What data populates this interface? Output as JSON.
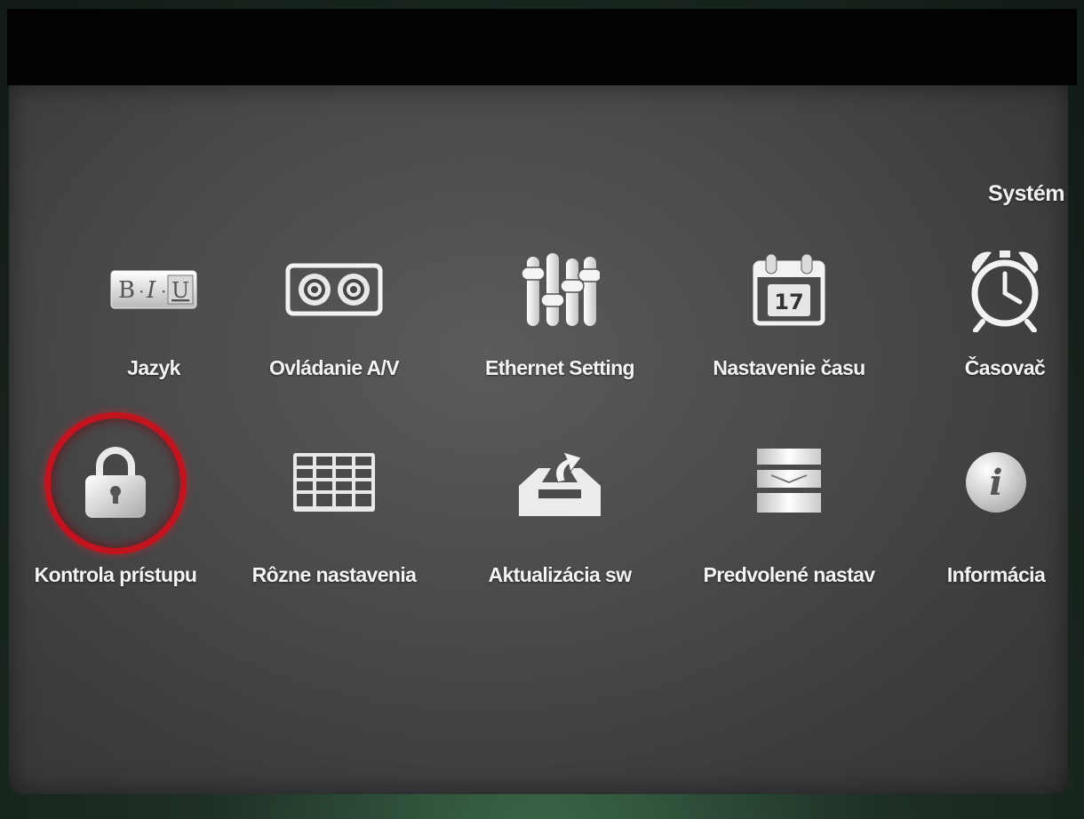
{
  "menu": {
    "title": "Systém",
    "accent_color": "#c2141f",
    "selected_index": 5,
    "items": [
      {
        "label": "Jazyk",
        "icon": "language-biu-icon"
      },
      {
        "label": "Ovládanie A/V",
        "icon": "av-speakers-icon"
      },
      {
        "label": "Ethernet Setting",
        "icon": "equalizer-sliders-icon"
      },
      {
        "label": "Nastavenie času",
        "icon": "calendar-icon",
        "icon_text": "17"
      },
      {
        "label": "Časovač",
        "icon": "alarm-clock-icon"
      },
      {
        "label": "Kontrola prístupu",
        "icon": "padlock-icon"
      },
      {
        "label": "Rôzne nastavenia",
        "icon": "grid-table-icon"
      },
      {
        "label": "Aktualizácia sw",
        "icon": "inbox-update-icon"
      },
      {
        "label": "Predvolené nastav",
        "icon": "reset-layers-icon"
      },
      {
        "label": "Informácia",
        "icon": "info-icon",
        "icon_text": "i"
      }
    ]
  }
}
